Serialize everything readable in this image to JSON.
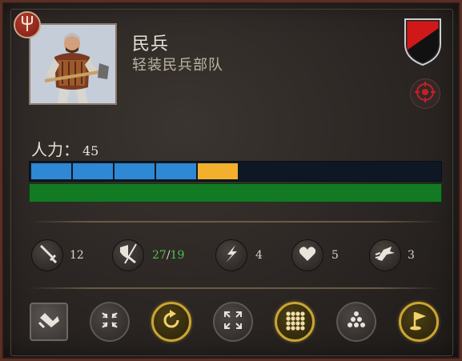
{
  "unit": {
    "name": "民兵",
    "type": "轻装民兵部队",
    "badge_icon": "pitchfork-icon",
    "faction_colors": [
      "#d01818",
      "#111111"
    ]
  },
  "manpower": {
    "label": "人力：",
    "value": "45"
  },
  "manpower_bar": {
    "segments": [
      {
        "color": "#2e88d4"
      },
      {
        "color": "#2e88d4"
      },
      {
        "color": "#2e88d4"
      },
      {
        "color": "#2e88d4"
      },
      {
        "color": "#f2b02c"
      }
    ],
    "bottom_color": "#137a24"
  },
  "stats": [
    {
      "icon": "sword-icon",
      "value": "12"
    },
    {
      "icon": "shield-sword-icon",
      "value_a": "27",
      "sep": "/",
      "value_b": "19"
    },
    {
      "icon": "lightning-icon",
      "value": "4"
    },
    {
      "icon": "heart-icon",
      "value": "5"
    },
    {
      "icon": "charge-icon",
      "value": "3"
    }
  ],
  "actions": [
    {
      "icon": "guard-mode-icon",
      "style": "square"
    },
    {
      "icon": "tighten-formation-icon",
      "style": "grey"
    },
    {
      "icon": "rotate-icon",
      "style": "gold"
    },
    {
      "icon": "loose-formation-icon",
      "style": "grey"
    },
    {
      "icon": "square-formation-icon",
      "style": "gold"
    },
    {
      "icon": "wedge-formation-icon",
      "style": "grey"
    },
    {
      "icon": "rally-flag-icon",
      "style": "gold"
    }
  ]
}
